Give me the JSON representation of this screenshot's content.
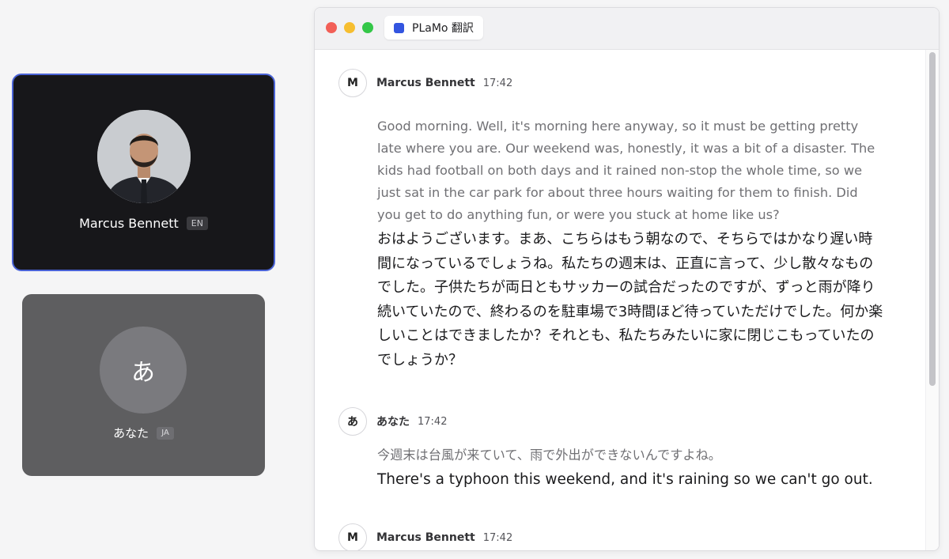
{
  "participants": {
    "remote": {
      "name": "Marcus Bennett",
      "lang": "EN"
    },
    "local": {
      "name": "あなた",
      "avatar_letter": "あ",
      "lang": "JA"
    }
  },
  "window": {
    "tab_title": "PLaMo 翻訳"
  },
  "messages": [
    {
      "avatar": "M",
      "name": "Marcus Bennett",
      "time": "17:42",
      "original": "Good morning. Well, it's morning here anyway, so it must be getting pretty late where you are. Our weekend was, honestly, it was a bit of a disaster. The kids had football on both days and it rained non-stop the whole time, so we just sat in the car park for about three hours waiting for them to finish. Did you get to do anything fun, or were you stuck at home like us?",
      "translation": "おはようございます。まあ、こちらはもう朝なので、そちらではかなり遅い時間になっているでしょうね。私たちの週末は、正直に言って、少し散々なものでした。子供たちが両日ともサッカーの試合だったのですが、ずっと雨が降り続いていたので、終わるのを駐車場で3時間ほど待っていただけでした。何か楽しいことはできましたか？それとも、私たちみたいに家に閉じこもっていたのでしょうか？"
    },
    {
      "avatar": "あ",
      "name": "あなた",
      "time": "17:42",
      "original": "今週末は台風が来ていて、雨で外出ができないんですよね。",
      "translation": "There's a typhoon this weekend, and it's raining so we can't go out."
    },
    {
      "avatar": "M",
      "name": "Marcus Bennett",
      "time": "17:42"
    }
  ],
  "colors": {
    "accent": "#3355e0",
    "remote_tile_border": "#4a63d6"
  }
}
